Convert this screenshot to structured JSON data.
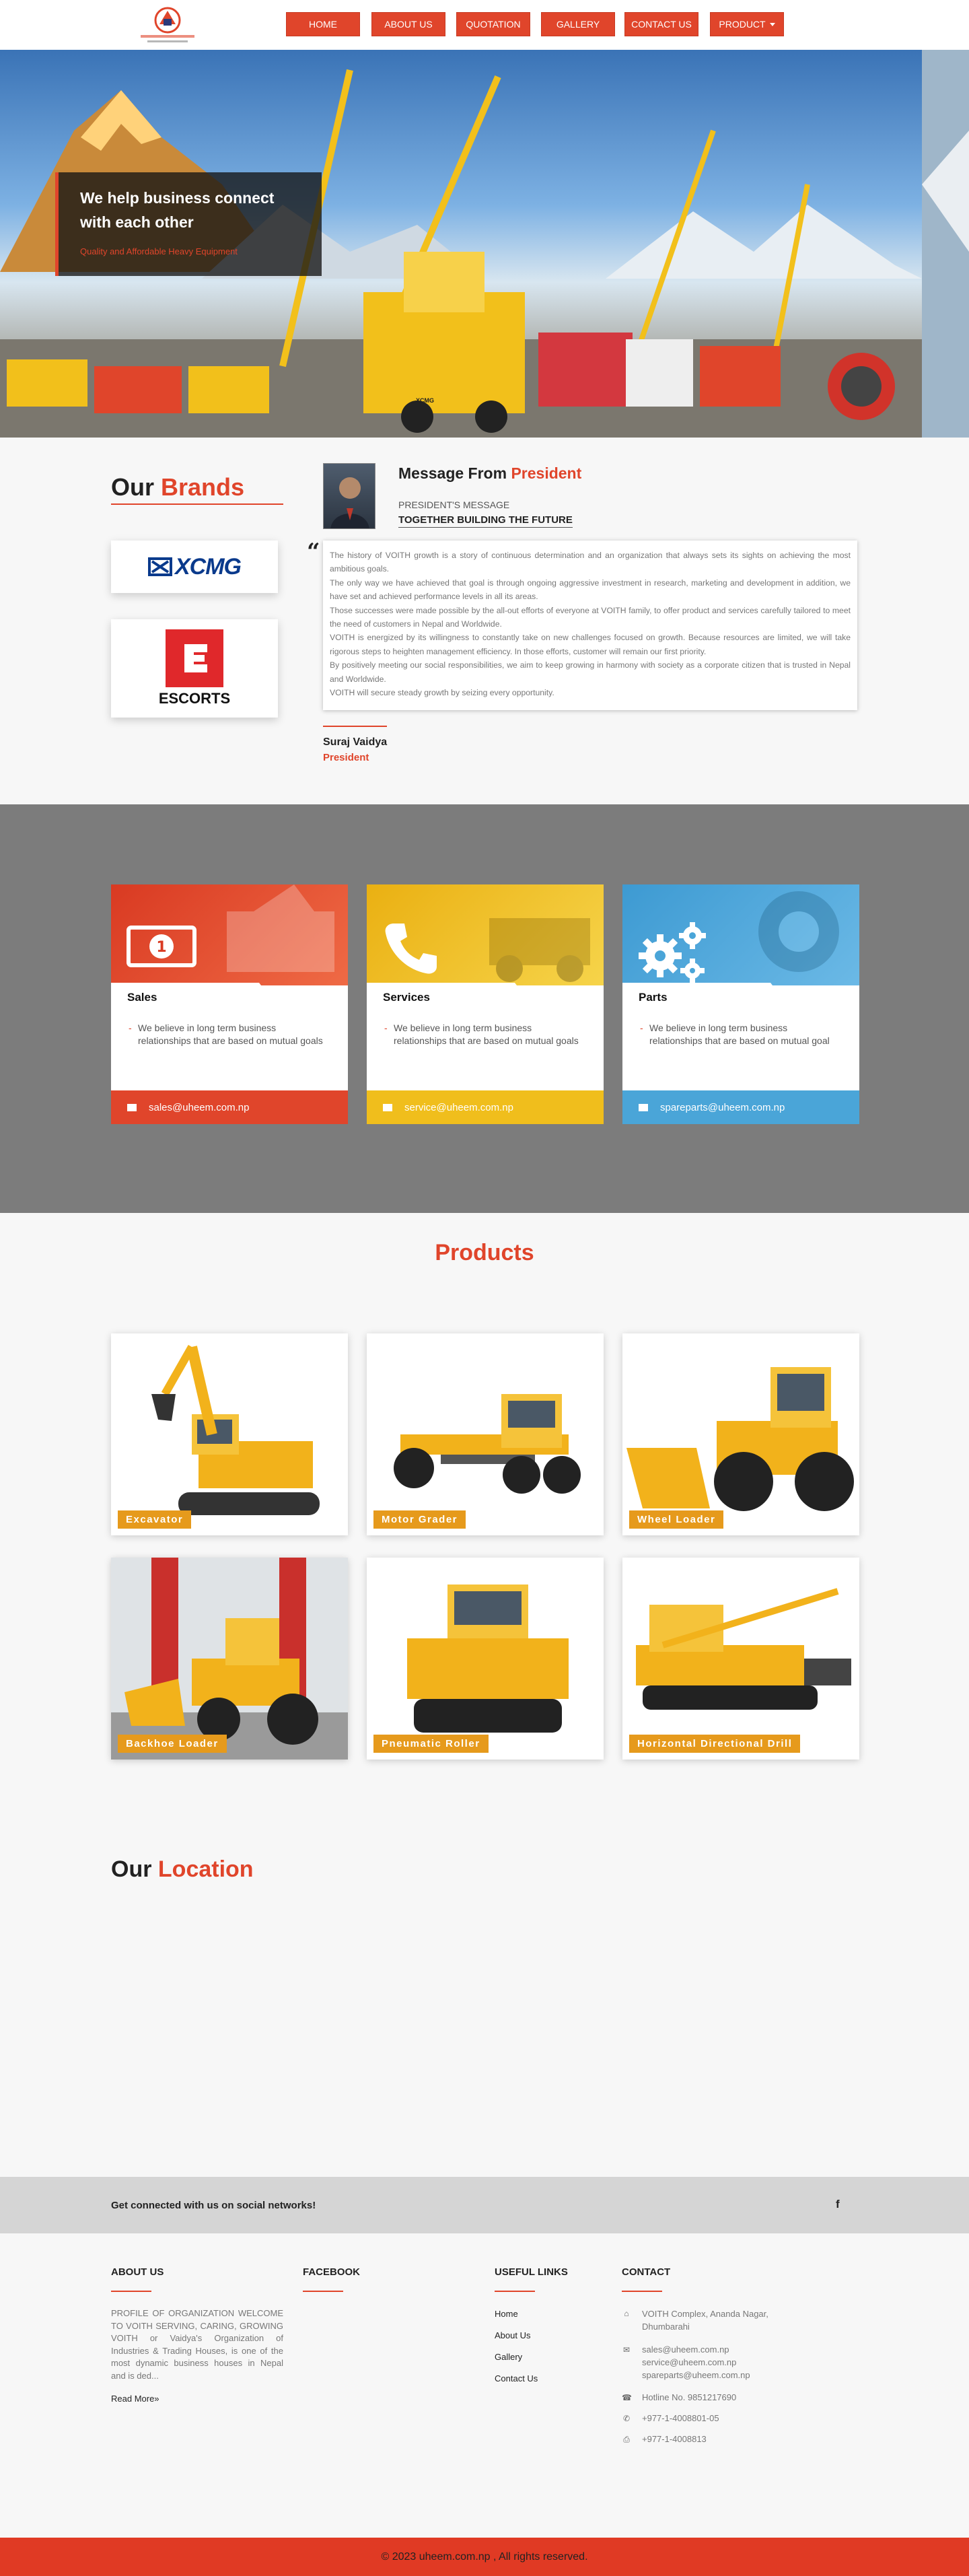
{
  "nav": {
    "logo_text": "United Heavy Equipment",
    "items": [
      "HOME",
      "ABOUT US",
      "QUOTATION",
      "GALLERY",
      "CONTACT US",
      "PRODUCT"
    ]
  },
  "hero": {
    "title": "We help business connect with each other",
    "subtitle": "Quality and Affordable Heavy Equipment",
    "banner_text": "XCMG"
  },
  "brands": {
    "title_prefix": "Our",
    "title_accent": "Brands",
    "logos": [
      "XCMG",
      "ESCORTS"
    ]
  },
  "message": {
    "title_prefix": "Message From",
    "title_accent": "President",
    "label": "PRESIDENT'S MESSAGE",
    "heading": "TOGETHER BUILDING THE FUTURE",
    "paragraphs": [
      "The history of VOITH growth is a story of continuous determination and an organization that always sets its sights on achieving the most ambitious goals.",
      "The only way we have achieved that goal is through ongoing aggressive investment in research, marketing and development in addition, we have set and achieved performance levels in all its areas.",
      "Those successes were made possible by the all-out efforts of everyone at VOITH family, to offer product and services carefully tailored to meet the need of customers in Nepal and Worldwide.",
      "VOITH is energized by its willingness to constantly take on new challenges focused on growth. Because resources are limited, we will take rigorous steps to heighten management efficiency. In those efforts, customer will remain our first priority.",
      "By positively meeting our social responsibilities, we aim to keep growing in harmony with society as a corporate citizen that is trusted in Nepal and Worldwide.",
      "VOITH will secure steady growth by seizing every opportunity."
    ],
    "signature_name": "Suraj Vaidya",
    "signature_role": "President"
  },
  "services": [
    {
      "name": "Sales",
      "text": "We believe in long term business relationships that are based on mutual goals",
      "email": "sales@uheem.com.np",
      "color": "#e0452b",
      "icon": "money-icon"
    },
    {
      "name": "Services",
      "text": "We believe in long term business relationships that are based on mutual goals",
      "email": "service@uheem.com.np",
      "color": "#f0be1c",
      "icon": "phone-icon"
    },
    {
      "name": "Parts",
      "text": "We believe in long term business relationships that are based on mutual goal",
      "email": "spareparts@uheem.com.np",
      "color": "#4aa5d8",
      "icon": "gears-icon"
    }
  ],
  "products": {
    "title": "Products",
    "items": [
      "Excavator",
      "Motor Grader",
      "Wheel Loader",
      "Backhoe Loader",
      "Pneumatic Roller",
      "Horizontal Directional Drill"
    ]
  },
  "location": {
    "title_prefix": "Our",
    "title_accent": "Location"
  },
  "social": {
    "text": "Get connected with us on social networks!",
    "icon": "f"
  },
  "footer": {
    "about": {
      "heading": "ABOUT US",
      "text": "PROFILE OF ORGANIZATION WELCOME TO VOITH SERVING, CARING, GROWING VOITH or Vaidya's Organization of Industries & Trading Houses, is one of the most dynamic business houses in Nepal and is ded...",
      "read_more": "Read More»"
    },
    "facebook": {
      "heading": "FACEBOOK"
    },
    "links": {
      "heading": "USEFUL LINKS",
      "items": [
        "Home",
        "About Us",
        "Gallery",
        "Contact Us"
      ]
    },
    "contact": {
      "heading": "CONTACT",
      "address": "VOITH Complex, Ananda Nagar, Dhumbarahi",
      "emails": [
        "sales@uheem.com.np",
        "service@uheem.com.np",
        "spareparts@uheem.com.np"
      ],
      "hotline": "Hotline No. 9851217690",
      "phone": "+977-1-4008801-05",
      "fax": "+977-1-4008813"
    }
  },
  "copyright": "© 2023 uheem.com.np , All rights reserved."
}
